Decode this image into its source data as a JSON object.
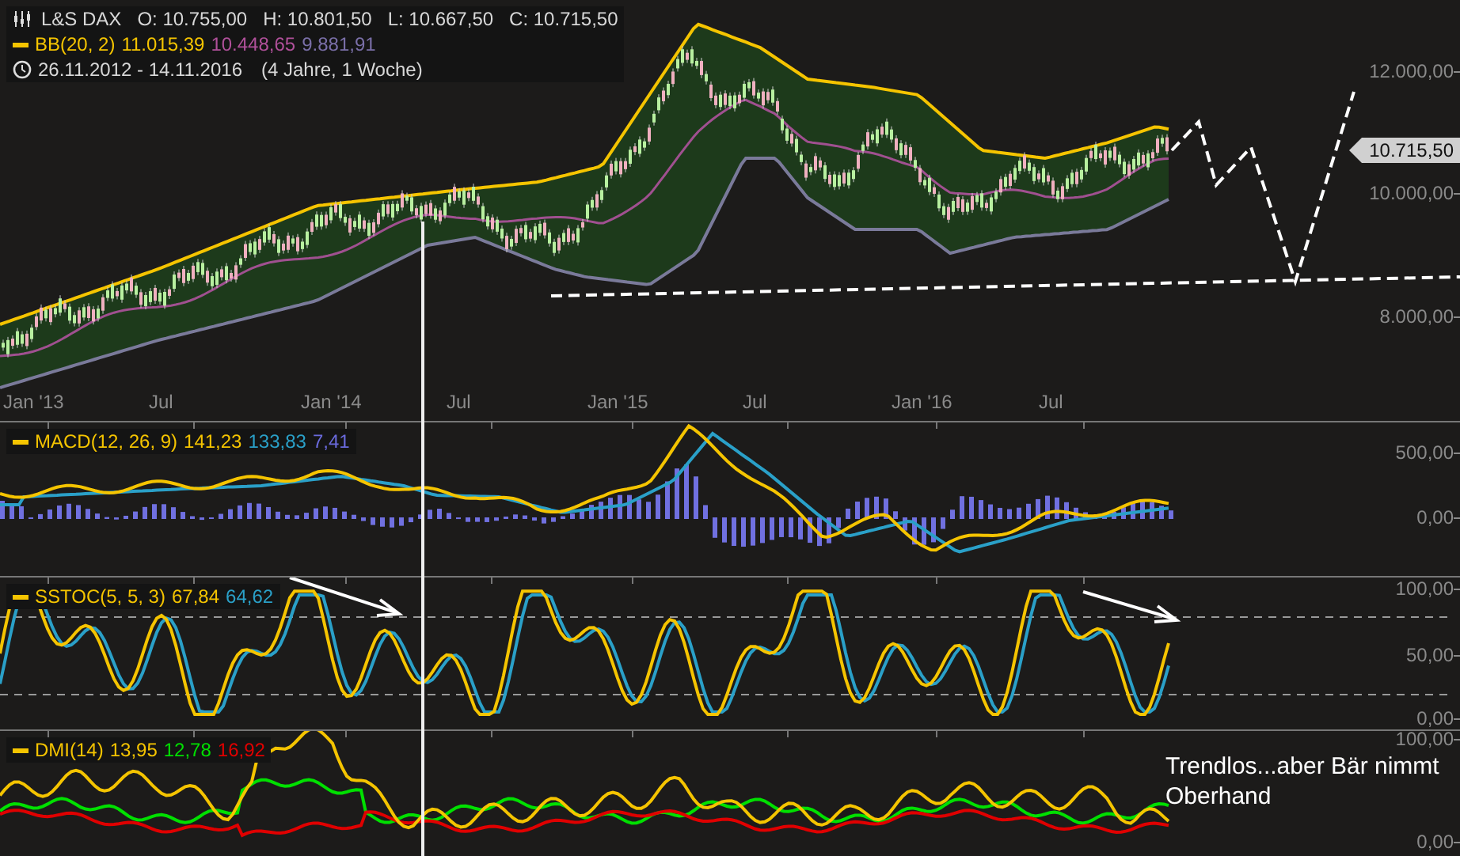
{
  "price_panel": {
    "legend": {
      "symbol": "L&S DAX",
      "ohlc": [
        "O: 10.755,00",
        "H: 10.801,50",
        "L: 10.667,50",
        "C: 10.715,50"
      ],
      "indicator": {
        "name": "BB(20, 2)",
        "values": [
          {
            "text": "11.015,39",
            "color": "#f5c400"
          },
          {
            "text": "10.448,65",
            "color": "#b0509a"
          },
          {
            "text": "9.881,91",
            "color": "#7a6fa8"
          }
        ]
      },
      "range": "26.11.2012 - 14.11.2016",
      "duration": "(4 Jahre, 1 Woche)"
    },
    "y_axis": [
      "12.000,00",
      "10.000,00",
      "8.000,00"
    ],
    "price_tag": "10.715,50",
    "x_axis": [
      "Jan '13",
      "Jul",
      "Jan '14",
      "Jul",
      "Jan '15",
      "Jul",
      "Jan '16",
      "Jul"
    ]
  },
  "macd_panel": {
    "legend": {
      "name": "MACD(12, 26, 9)",
      "values": [
        {
          "text": "141,23",
          "color": "#f5c400"
        },
        {
          "text": "133,83",
          "color": "#2aa0c8"
        },
        {
          "text": "7,41",
          "color": "#6a6adc"
        }
      ]
    },
    "y_axis": [
      "500,00",
      "0,00"
    ]
  },
  "stoch_panel": {
    "legend": {
      "name": "SSTOC(5, 5, 3)",
      "values": [
        {
          "text": "67,84",
          "color": "#f5c400"
        },
        {
          "text": "64,62",
          "color": "#2aa0c8"
        }
      ]
    },
    "y_axis": [
      "100,00",
      "50,00",
      "0,00"
    ]
  },
  "dmi_panel": {
    "legend": {
      "name": "DMI(14)",
      "values": [
        {
          "text": "13,95",
          "color": "#f5c400"
        },
        {
          "text": "12,78",
          "color": "#00e000"
        },
        {
          "text": "16,92",
          "color": "#e00000"
        }
      ]
    },
    "y_axis": [
      "100,00",
      "0,00"
    ],
    "annotation": "Trendlos...aber Bär nimmt Oberhand"
  }
}
